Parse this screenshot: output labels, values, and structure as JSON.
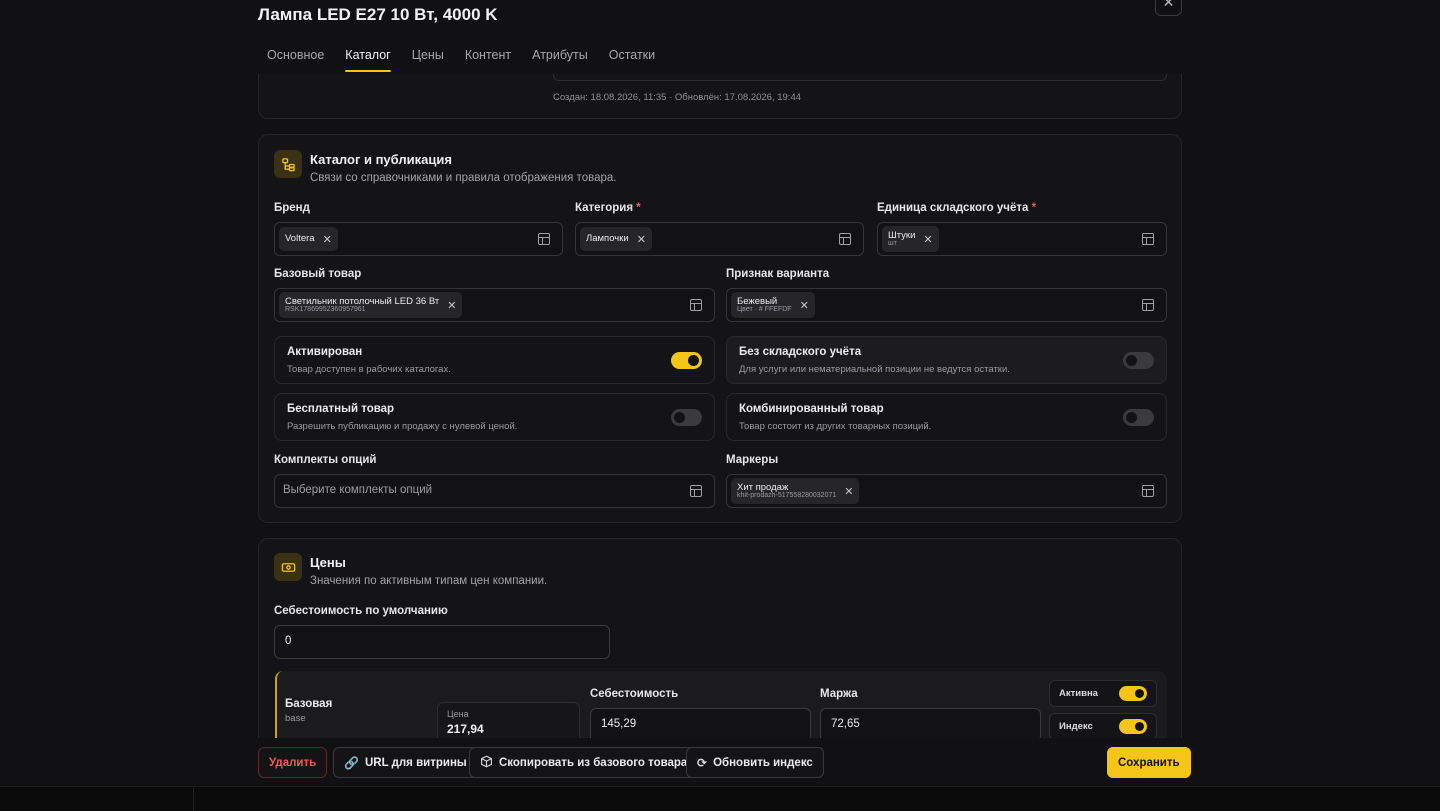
{
  "title": "Лампа LED E27 10 Вт, 4000 K",
  "tabs": [
    {
      "label": "Основное"
    },
    {
      "label": "Каталог"
    },
    {
      "label": "Цены"
    },
    {
      "label": "Контент"
    },
    {
      "label": "Атрибуты"
    },
    {
      "label": "Остатки"
    }
  ],
  "active_tab": "Каталог",
  "meta": "Создан: 18.08.2026, 11:35 · Обновлён: 17.08.2026, 19:44",
  "catalog": {
    "title": "Каталог и публикация",
    "subtitle": "Связи со справочниками и правила отображения товара.",
    "brand": {
      "label": "Бренд",
      "value": "Voltera"
    },
    "category": {
      "label": "Категория",
      "value": "Лампочки"
    },
    "unit": {
      "label": "Единица складского учёта",
      "value": "Штуки",
      "sub": "шт"
    },
    "base_product": {
      "label": "Базовый товар",
      "value": "Светильник потолочный LED 36 Вт",
      "sub": "RSK17869952360957961"
    },
    "variant": {
      "label": "Признак варианта",
      "value": "Бежевый",
      "sub": "Цвет · # FFEFDF"
    },
    "required_mark": "*",
    "toggles": [
      {
        "title": "Активирован",
        "desc": "Товар доступен в рабочих каталогах.",
        "on": true
      },
      {
        "title": "Без складского учёта",
        "desc": "Для услуги или нематериальной позиции не ведутся остатки.",
        "on": false
      },
      {
        "title": "Бесплатный товар",
        "desc": "Разрешить публикацию и продажу с нулевой ценой.",
        "on": false
      },
      {
        "title": "Комбинированный товар",
        "desc": "Товар состоит из других товарных позиций.",
        "on": false
      }
    ],
    "option_sets": {
      "label": "Комплекты опций",
      "placeholder": "Выберите комплекты опций"
    },
    "markers": {
      "label": "Маркеры",
      "value": "Хит продаж",
      "sub": "khit-prodazh-517558280032071"
    }
  },
  "prices": {
    "title": "Цены",
    "subtitle": "Значения по активным типам цен компании.",
    "default_cost_label": "Себестоимость по умолчанию",
    "default_cost_value": "0",
    "row": {
      "name": "Базовая",
      "code": "base",
      "price_label": "Цена",
      "price_value": "217,94",
      "cost_label": "Себестоимость",
      "cost_value": "145,29",
      "margin_label": "Маржа",
      "margin_value": "72,65",
      "active_label": "Активна",
      "active_on": true,
      "index_label": "Индекс",
      "index_on": true
    }
  },
  "footer": {
    "delete": "Удалить",
    "url": "URL для витрины",
    "copy": "Скопировать из базового товара",
    "refresh": "Обновить индекс",
    "save": "Сохранить"
  },
  "colors": {
    "accent": "#f5c518",
    "danger": "#ef5a5a",
    "background": "#111113"
  }
}
